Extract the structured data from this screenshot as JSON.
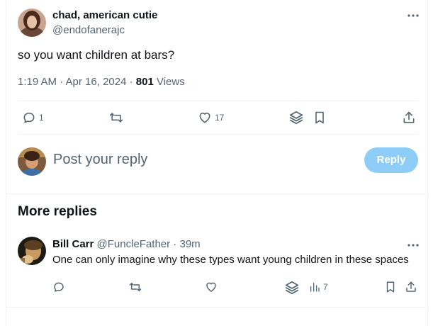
{
  "tweet": {
    "author_name": "chad, american cutie",
    "author_handle": "@endofanerajc",
    "text": "so you want children at bars?",
    "time": "1:19 AM · Apr 16, 2024 · ",
    "views_count": "801",
    "views_label": " Views",
    "reply_count": "1",
    "like_count": "17",
    "more_icon": "more-horizontal-icon"
  },
  "composer": {
    "placeholder": "Post your reply",
    "button_label": "Reply",
    "button_color": "#8ecdf7"
  },
  "more_replies": {
    "heading": "More replies",
    "items": [
      {
        "author_name": "Bill Carr",
        "author_handle": "@FuncleFather",
        "time": " · 39m",
        "text": "One can only imagine why these types want young children in these spaces",
        "views_count": "7"
      }
    ]
  },
  "colors": {
    "text": "#0f1419",
    "muted": "#536471",
    "border": "#eff3f4"
  }
}
